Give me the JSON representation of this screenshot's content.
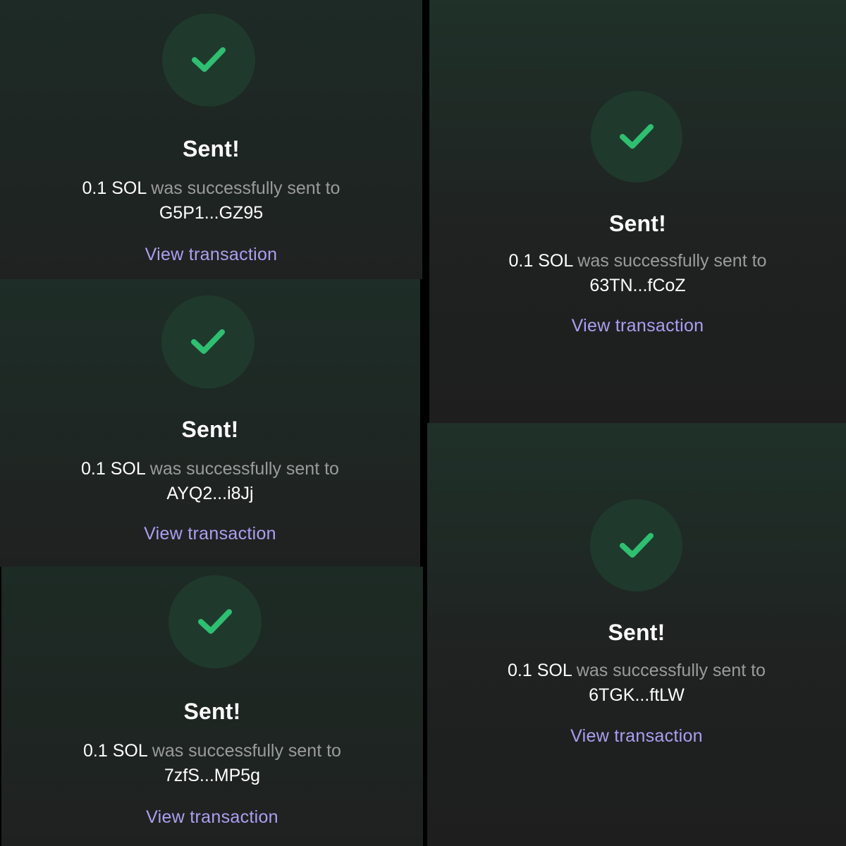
{
  "colors": {
    "check_green": "#2fbf71",
    "circle_fill": "#1f3a2d",
    "link_purple": "#ab9ff2",
    "panel_top": "#1e2f28",
    "panel_bottom": "#1f1f1f"
  },
  "icons": {
    "success": "checkmark-icon"
  },
  "panels": [
    {
      "title": "Sent!",
      "amount": "0.1 SOL",
      "message": " was successfully sent to",
      "address": "G5P1...GZ95",
      "link": "View transaction"
    },
    {
      "title": "Sent!",
      "amount": "0.1 SOL",
      "message": " was successfully sent to",
      "address": "AYQ2...i8Jj",
      "link": "View transaction"
    },
    {
      "title": "Sent!",
      "amount": "0.1 SOL",
      "message": " was successfully sent to",
      "address": "7zfS...MP5g",
      "link": "View transaction"
    },
    {
      "title": "Sent!",
      "amount": "0.1 SOL",
      "message": " was successfully sent to",
      "address": "63TN...fCoZ",
      "link": "View transaction"
    },
    {
      "title": "Sent!",
      "amount": "0.1 SOL",
      "message": " was successfully sent to",
      "address": "6TGK...ftLW",
      "link": "View transaction"
    }
  ]
}
